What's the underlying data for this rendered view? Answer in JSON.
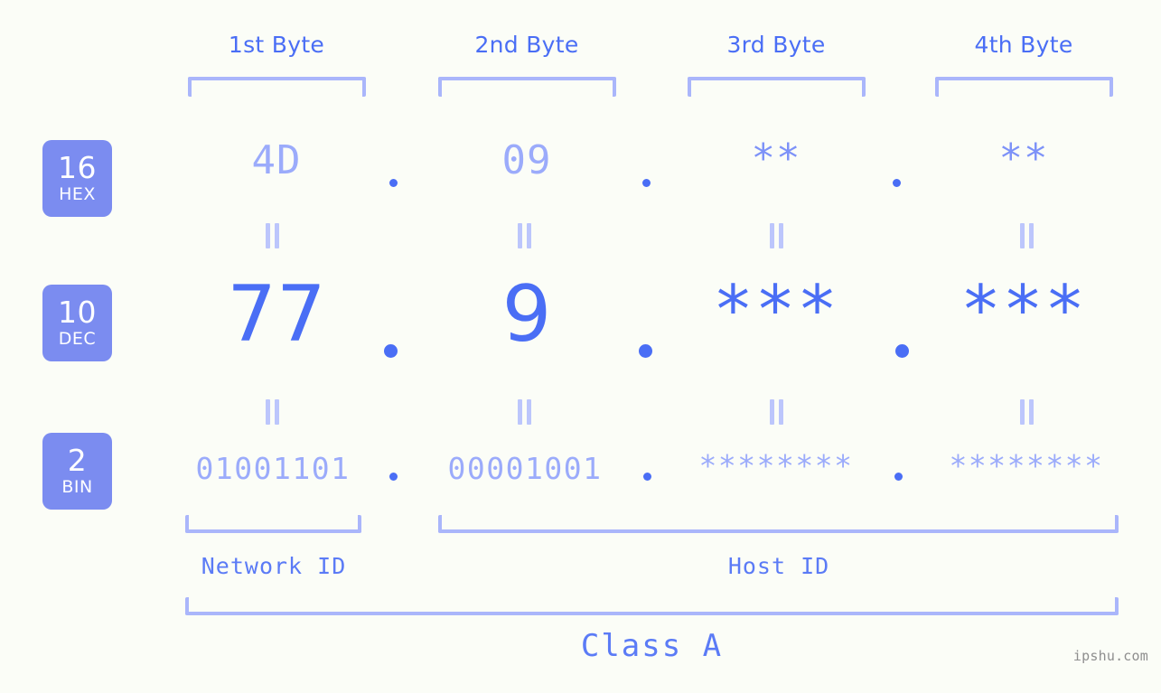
{
  "watermark": "ipshu.com",
  "bytes": [
    {
      "label": "1st Byte"
    },
    {
      "label": "2nd Byte"
    },
    {
      "label": "3rd Byte"
    },
    {
      "label": "4th Byte"
    }
  ],
  "radix": [
    {
      "number": "16",
      "name": "HEX"
    },
    {
      "number": "10",
      "name": "DEC"
    },
    {
      "number": "2",
      "name": "BIN"
    }
  ],
  "rows": {
    "hex": {
      "values": [
        "4D",
        "09",
        "**",
        "**"
      ],
      "masked": [
        false,
        false,
        true,
        true
      ]
    },
    "dec": {
      "values": [
        "77",
        "9",
        "***",
        "***"
      ],
      "masked": [
        false,
        false,
        true,
        true
      ]
    },
    "bin": {
      "values": [
        "01001101",
        "00001001",
        "********",
        "********"
      ],
      "masked": [
        false,
        false,
        true,
        true
      ]
    }
  },
  "separator": {
    "glyph": "."
  },
  "equals": {
    "glyph": "="
  },
  "segments": {
    "network_id": "Network ID",
    "host_id": "Host ID",
    "class": "Class A"
  },
  "colors": {
    "background": "#fbfdf7",
    "accent": "#4a6ef5",
    "accent_light": "#9babfb",
    "bracket": "#aab6fb",
    "badge": "#7b8cf0"
  }
}
